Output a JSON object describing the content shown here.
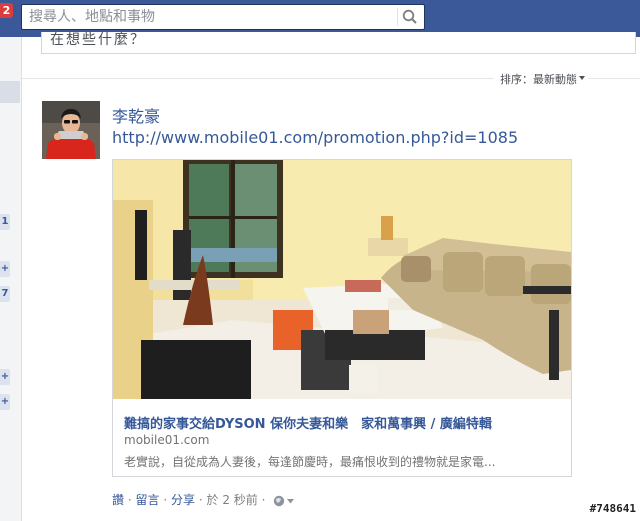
{
  "topbar": {
    "notification_count": "2",
    "search_placeholder": "搜尋人、地點和事物"
  },
  "leftnav": {
    "counts": [
      "1",
      "+",
      "7",
      "+",
      "+"
    ]
  },
  "composer": {
    "placeholder": "在想些什麼？"
  },
  "feed": {
    "sort_label": "排序：最新動態"
  },
  "post": {
    "author": "李乾豪",
    "link_text": "http://www.mobile01.com/promotion.php?id=1085",
    "card": {
      "title": "難搞的家事交給DYSON 保你夫妻和樂　家和萬事興 / 廣編特輯",
      "domain": "mobile01.com",
      "description": "老實說，自從成為人妻後，每逢節慶時，最痛恨收到的禮物就是家電..."
    },
    "actions": {
      "like": "讚",
      "dot1": "·",
      "comment": "留言",
      "dot2": "·",
      "share": "分享",
      "dot3": "·",
      "time_prefix": "於",
      "time": "2 秒前",
      "dot4": "·"
    }
  },
  "watermark": "#748641",
  "colors": {
    "topbar": "#3b5998",
    "link": "#365899",
    "badge": "#dd3c3c"
  }
}
